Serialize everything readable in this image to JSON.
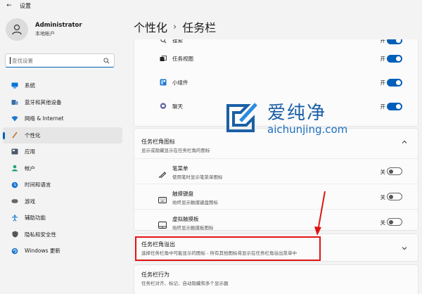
{
  "titlebar": {
    "title": "设置"
  },
  "user": {
    "name": "Administrator",
    "account_type": "本地帐户"
  },
  "search": {
    "placeholder": "查找设置"
  },
  "nav": [
    {
      "label": "系统",
      "icon": "monitor-icon",
      "color": "#0a73d8"
    },
    {
      "label": "蓝牙和其他设备",
      "icon": "bluetooth-devices-icon",
      "color": "#3a6ea5"
    },
    {
      "label": "网络 & Internet",
      "icon": "wifi-icon",
      "color": "#1b78d0"
    },
    {
      "label": "个性化",
      "icon": "brush-icon",
      "color": "#b87333",
      "active": true
    },
    {
      "label": "应用",
      "icon": "apps-icon",
      "color": "#4a5a6a"
    },
    {
      "label": "帐户",
      "icon": "person-icon",
      "color": "#1aa37a"
    },
    {
      "label": "时间和语言",
      "icon": "globe-clock-icon",
      "color": "#1b78d0"
    },
    {
      "label": "游戏",
      "icon": "gamepad-icon",
      "color": "#666"
    },
    {
      "label": "辅助功能",
      "icon": "accessibility-icon",
      "color": "#1b78d0"
    },
    {
      "label": "隐私和安全性",
      "icon": "shield-icon",
      "color": "#555"
    },
    {
      "label": "Windows 更新",
      "icon": "update-icon",
      "color": "#1b78d0"
    }
  ],
  "breadcrumb": {
    "parent": "个性化",
    "current": "任务栏"
  },
  "taskbar_items": [
    {
      "label": "搜索",
      "state": "开",
      "on": true,
      "icon": "search-icon"
    },
    {
      "label": "任务视图",
      "state": "开",
      "on": true,
      "icon": "task-view-icon"
    },
    {
      "label": "小组件",
      "state": "开",
      "on": true,
      "icon": "widgets-icon"
    },
    {
      "label": "聊天",
      "state": "开",
      "on": true,
      "icon": "chat-icon"
    }
  ],
  "corner_icons": {
    "title": "任务栏角图标",
    "subtitle": "显示或隐藏显示在任务栏角的图标",
    "items": [
      {
        "label": "笔菜单",
        "desc": "使用笔时显示笔菜单图标",
        "state": "关",
        "on": false,
        "icon": "pen-icon"
      },
      {
        "label": "触摸键盘",
        "desc": "始终显示触摸键盘图标",
        "state": "关",
        "on": false,
        "icon": "keyboard-icon"
      },
      {
        "label": "虚拟触摸板",
        "desc": "始终显示触摸板图标",
        "state": "关",
        "on": false,
        "icon": "touchpad-icon"
      }
    ]
  },
  "corner_overflow": {
    "title": "任务栏角溢出",
    "subtitle": "选择任务栏角中可能显示的图标 - 所有其他图标将显示在任务栏角溢出菜单中"
  },
  "behaviors": {
    "title": "任务栏行为",
    "subtitle": "任务栏对齐、标记、自动隐藏和多个显示器"
  },
  "watermark": {
    "cn": "爱纯净",
    "en": "aichunjing.com"
  },
  "colors": {
    "accent": "#005fb8",
    "highlight": "#e01414"
  }
}
